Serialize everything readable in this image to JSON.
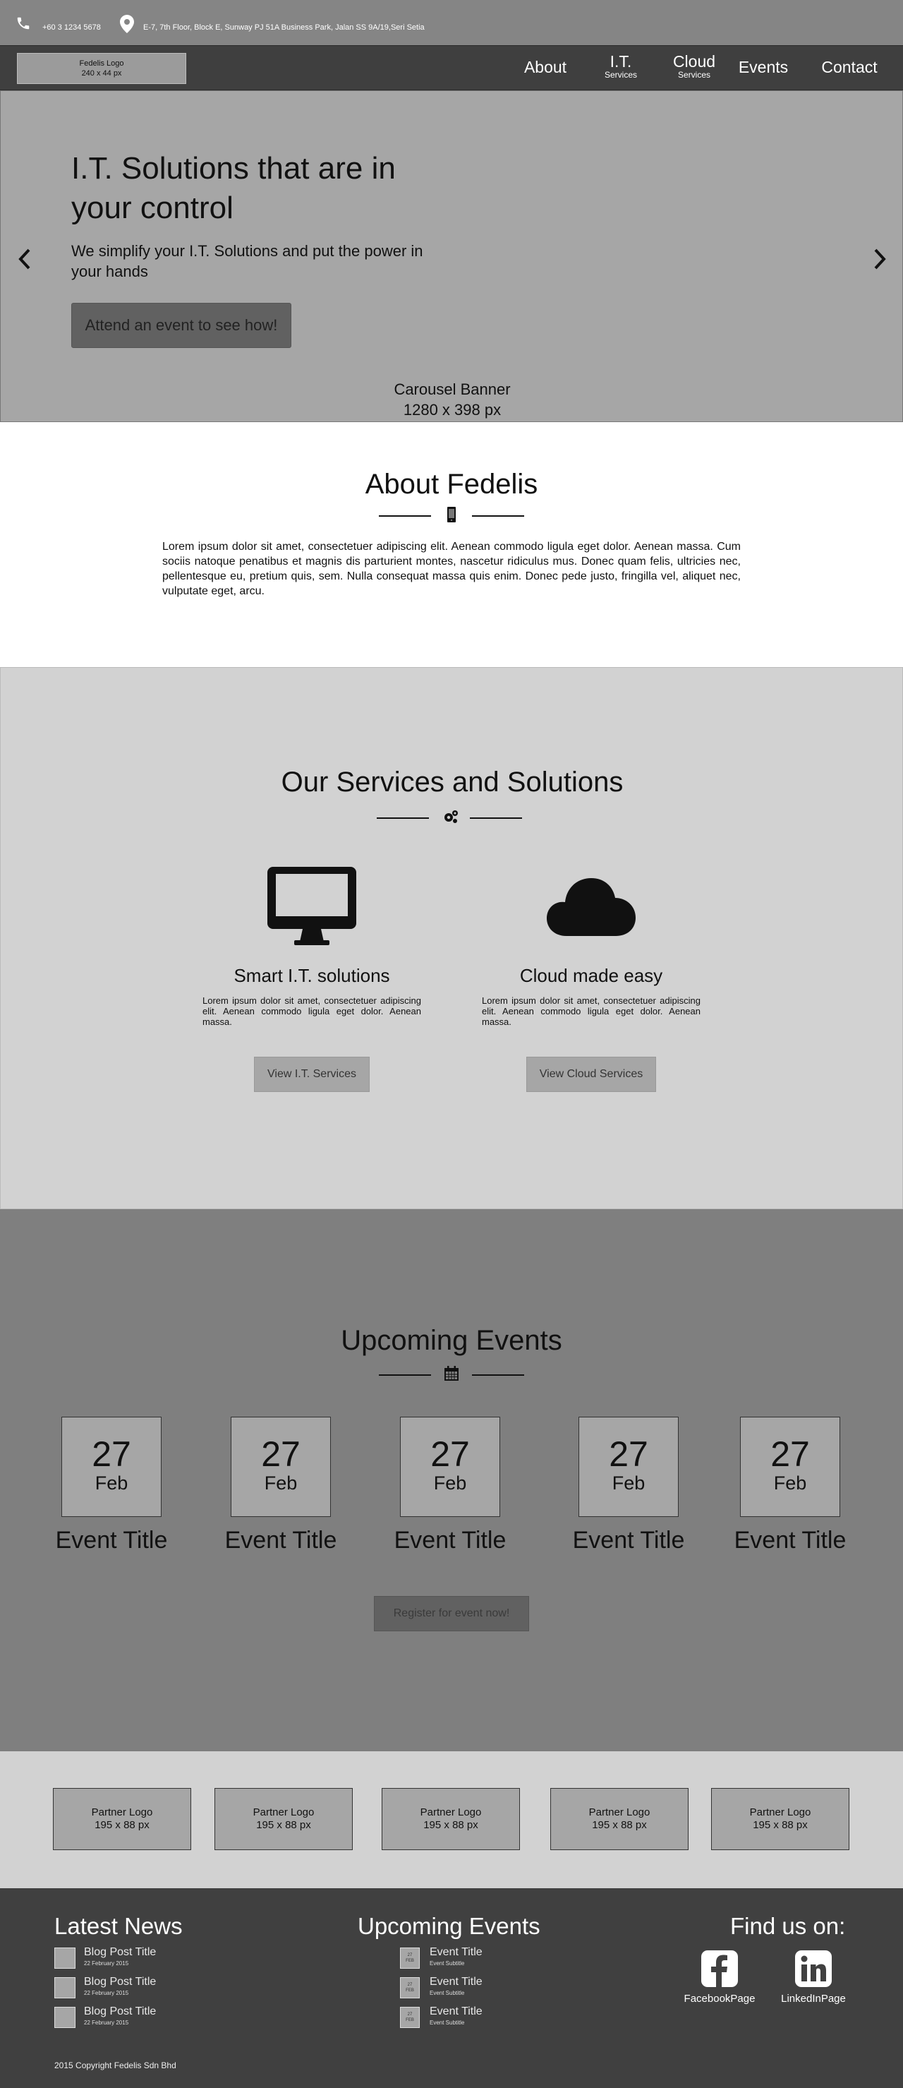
{
  "topbar": {
    "phone": "+60 3 1234 5678",
    "address": "E-7, 7th Floor, Block E, Sunway PJ 51A Business Park, Jalan SS 9A/19,Seri Setia"
  },
  "nav": {
    "logo_line1": "Fedelis Logo",
    "logo_line2": "240 x 44 px",
    "items": [
      {
        "label": "About",
        "sub": ""
      },
      {
        "label": "I.T.",
        "sub": "Services"
      },
      {
        "label": "Cloud",
        "sub": "Services"
      },
      {
        "label": "Events",
        "sub": ""
      },
      {
        "label": "Contact",
        "sub": ""
      }
    ]
  },
  "hero": {
    "title": "I.T. Solutions that are in your control",
    "subtitle": "We simplify your I.T. Solutions and put the power in your hands",
    "cta": "Attend an event to see how!",
    "caption_line1": "Carousel Banner",
    "caption_line2": "1280 x 398 px"
  },
  "about": {
    "title": "About Fedelis",
    "body": "Lorem ipsum dolor sit amet, consectetuer adipiscing elit. Aenean commodo ligula eget dolor. Aenean massa. Cum sociis natoque penatibus et magnis dis parturient montes, nascetur ridiculus mus. Donec quam felis, ultricies nec, pellentesque eu, pretium quis, sem. Nulla consequat massa quis enim. Donec pede justo, fringilla vel, aliquet nec, vulputate eget, arcu."
  },
  "services": {
    "title": "Our Services and Solutions",
    "items": [
      {
        "title": "Smart I.T.  solutions",
        "body": "Lorem ipsum dolor sit amet, consectetuer adipiscing elit. Aenean commodo ligula eget dolor. Aenean massa.",
        "button": "View I.T. Services",
        "icon": "monitor-icon"
      },
      {
        "title": "Cloud  made easy",
        "body": "Lorem ipsum dolor sit amet, consectetuer adipiscing elit. Aenean commodo ligula eget dolor. Aenean massa.",
        "button": "View Cloud Services",
        "icon": "cloud-icon"
      }
    ]
  },
  "events": {
    "title": "Upcoming Events",
    "items": [
      {
        "day": "27",
        "month": "Feb",
        "title": "Event Title"
      },
      {
        "day": "27",
        "month": "Feb",
        "title": "Event Title"
      },
      {
        "day": "27",
        "month": "Feb",
        "title": "Event Title"
      },
      {
        "day": "27",
        "month": "Feb",
        "title": "Event Title"
      },
      {
        "day": "27",
        "month": "Feb",
        "title": "Event Title"
      }
    ],
    "register": "Register for event now!"
  },
  "partners": [
    {
      "line1": "Partner Logo",
      "line2": "195 x 88 px"
    },
    {
      "line1": "Partner Logo",
      "line2": "195 x 88 px"
    },
    {
      "line1": "Partner Logo",
      "line2": "195 x 88 px"
    },
    {
      "line1": "Partner Logo",
      "line2": "195 x 88 px"
    },
    {
      "line1": "Partner Logo",
      "line2": "195 x 88 px"
    }
  ],
  "footer": {
    "news_title": "Latest News",
    "news": [
      {
        "title": "Blog Post Title",
        "date": "22 February 2015"
      },
      {
        "title": "Blog Post Title",
        "date": "22 February 2015"
      },
      {
        "title": "Blog Post Title",
        "date": "22 February 2015"
      }
    ],
    "events_title": "Upcoming Events",
    "events": [
      {
        "day": "27",
        "month": "FEB",
        "title": "Event Title",
        "subtitle": "Event Subtitle"
      },
      {
        "day": "27",
        "month": "FEB",
        "title": "Event Title",
        "subtitle": "Event Subtitle"
      },
      {
        "day": "27",
        "month": "FEB",
        "title": "Event Title",
        "subtitle": "Event Subtitle"
      }
    ],
    "find_title": "Find us on:",
    "facebook": "FacebookPage",
    "linkedin": "LinkedInPage",
    "copyright": "2015 Copyright Fedelis Sdn Bhd"
  }
}
